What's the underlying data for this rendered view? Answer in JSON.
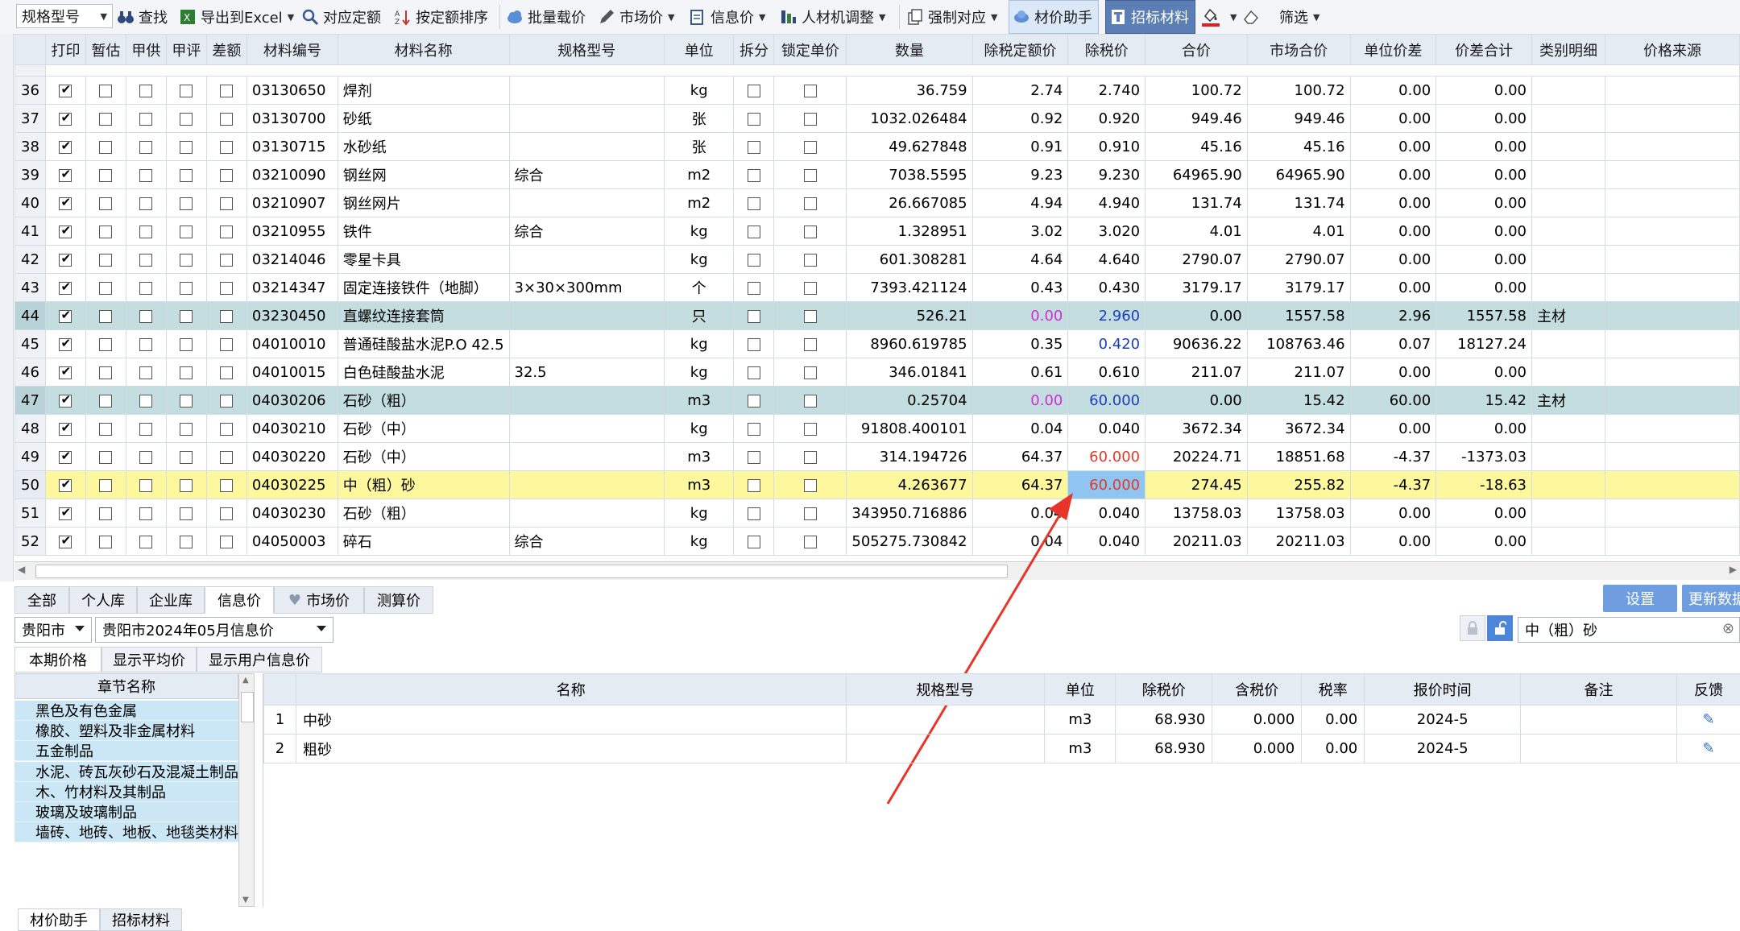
{
  "toolbar": {
    "spec_filter": "规格型号",
    "find": "查找",
    "export_excel": "导出到Excel",
    "match_quota": "对应定额",
    "sort_by_quota": "按定额排序",
    "batch_price": "批量载价",
    "market_price": "市场价",
    "info_price": "信息价",
    "labor_adjust": "人材机调整",
    "force_match": "强制对应",
    "material_assistant": "材价助手",
    "bid_material": "招标材料",
    "filter": "筛选"
  },
  "grid": {
    "columns": [
      "",
      "打印",
      "暂估",
      "甲供",
      "甲评",
      "差额",
      "材料编号",
      "材料名称",
      "规格型号",
      "单位",
      "拆分",
      "锁定单价",
      "数量",
      "除税定额价",
      "除税价",
      "合价",
      "市场合价",
      "单位价差",
      "价差合计",
      "类别明细",
      "价格来源"
    ],
    "rows": [
      {
        "rn": "36",
        "print": true,
        "code": "03130650",
        "name": "焊剂",
        "spec": "",
        "unit": "kg",
        "qty": "36.759",
        "quota": "2.74",
        "price": "2.740",
        "total": "100.72",
        "mtotal": "100.72",
        "diff": "0.00",
        "difft": "0.00",
        "cat": "",
        "style": ""
      },
      {
        "rn": "37",
        "print": true,
        "code": "03130700",
        "name": "砂纸",
        "spec": "",
        "unit": "张",
        "qty": "1032.026484",
        "quota": "0.92",
        "price": "0.920",
        "total": "949.46",
        "mtotal": "949.46",
        "diff": "0.00",
        "difft": "0.00",
        "cat": "",
        "style": ""
      },
      {
        "rn": "38",
        "print": true,
        "code": "03130715",
        "name": "水砂纸",
        "spec": "",
        "unit": "张",
        "qty": "49.627848",
        "quota": "0.91",
        "price": "0.910",
        "total": "45.16",
        "mtotal": "45.16",
        "diff": "0.00",
        "difft": "0.00",
        "cat": "",
        "style": ""
      },
      {
        "rn": "39",
        "print": true,
        "code": "03210090",
        "name": "钢丝网",
        "spec": "综合",
        "unit": "m2",
        "qty": "7038.5595",
        "quota": "9.23",
        "price": "9.230",
        "total": "64965.90",
        "mtotal": "64965.90",
        "diff": "0.00",
        "difft": "0.00",
        "cat": "",
        "style": ""
      },
      {
        "rn": "40",
        "print": true,
        "code": "03210907",
        "name": "钢丝网片",
        "spec": "",
        "unit": "m2",
        "qty": "26.667085",
        "quota": "4.94",
        "price": "4.940",
        "total": "131.74",
        "mtotal": "131.74",
        "diff": "0.00",
        "difft": "0.00",
        "cat": "",
        "style": ""
      },
      {
        "rn": "41",
        "print": true,
        "code": "03210955",
        "name": "铁件",
        "spec": "综合",
        "unit": "kg",
        "qty": "1.328951",
        "quota": "3.02",
        "price": "3.020",
        "total": "4.01",
        "mtotal": "4.01",
        "diff": "0.00",
        "difft": "0.00",
        "cat": "",
        "style": ""
      },
      {
        "rn": "42",
        "print": true,
        "code": "03214046",
        "name": "零星卡具",
        "spec": "",
        "unit": "kg",
        "qty": "601.308281",
        "quota": "4.64",
        "price": "4.640",
        "total": "2790.07",
        "mtotal": "2790.07",
        "diff": "0.00",
        "difft": "0.00",
        "cat": "",
        "style": ""
      },
      {
        "rn": "43",
        "print": true,
        "code": "03214347",
        "name": "固定连接铁件（地脚）",
        "spec": "3×30×300mm",
        "unit": "个",
        "qty": "7393.421124",
        "quota": "0.43",
        "price": "0.430",
        "total": "3179.17",
        "mtotal": "3179.17",
        "diff": "0.00",
        "difft": "0.00",
        "cat": "",
        "style": ""
      },
      {
        "rn": "44",
        "print": true,
        "code": "03230450",
        "name": "直螺纹连接套筒",
        "spec": "",
        "unit": "只",
        "qty": "526.21",
        "quota": "0.00",
        "price": "2.960",
        "total": "0.00",
        "mtotal": "1557.58",
        "diff": "2.96",
        "difft": "1557.58",
        "cat": "主材",
        "style": "zu"
      },
      {
        "rn": "45",
        "print": true,
        "code": "04010010",
        "name": "普通硅酸盐水泥P.O 42.5",
        "spec": "",
        "unit": "kg",
        "qty": "8960.619785",
        "quota": "0.35",
        "price": "0.420",
        "total": "90636.22",
        "mtotal": "108763.46",
        "diff": "0.07",
        "difft": "18127.24",
        "cat": "",
        "style": "blueprice"
      },
      {
        "rn": "46",
        "print": true,
        "code": "04010015",
        "name": "白色硅酸盐水泥",
        "spec": "32.5",
        "unit": "kg",
        "qty": "346.01841",
        "quota": "0.61",
        "price": "0.610",
        "total": "211.07",
        "mtotal": "211.07",
        "diff": "0.00",
        "difft": "0.00",
        "cat": "",
        "style": ""
      },
      {
        "rn": "47",
        "print": true,
        "code": "04030206",
        "name": "石砂（粗）",
        "spec": "",
        "unit": "m3",
        "qty": "0.25704",
        "quota": "0.00",
        "price": "60.000",
        "total": "0.00",
        "mtotal": "15.42",
        "diff": "60.00",
        "difft": "15.42",
        "cat": "主材",
        "style": "zu"
      },
      {
        "rn": "48",
        "print": true,
        "code": "04030210",
        "name": "石砂（中）",
        "spec": "",
        "unit": "kg",
        "qty": "91808.400101",
        "quota": "0.04",
        "price": "0.040",
        "total": "3672.34",
        "mtotal": "3672.34",
        "diff": "0.00",
        "difft": "0.00",
        "cat": "",
        "style": ""
      },
      {
        "rn": "49",
        "print": true,
        "code": "04030220",
        "name": "石砂（中）",
        "spec": "",
        "unit": "m3",
        "qty": "314.194726",
        "quota": "64.37",
        "price": "60.000",
        "total": "20224.71",
        "mtotal": "18851.68",
        "diff": "-4.37",
        "difft": "-1373.03",
        "cat": "",
        "style": "redprice"
      },
      {
        "rn": "50",
        "print": true,
        "code": "04030225",
        "name": "中（粗）砂",
        "spec": "",
        "unit": "m3",
        "qty": "4.263677",
        "quota": "64.37",
        "price": "60.000",
        "total": "274.45",
        "mtotal": "255.82",
        "diff": "-4.37",
        "difft": "-18.63",
        "cat": "",
        "style": "sel"
      },
      {
        "rn": "51",
        "print": true,
        "code": "04030230",
        "name": "石砂（粗）",
        "spec": "",
        "unit": "kg",
        "qty": "343950.716886",
        "quota": "0.04",
        "price": "0.040",
        "total": "13758.03",
        "mtotal": "13758.03",
        "diff": "0.00",
        "difft": "0.00",
        "cat": "",
        "style": ""
      },
      {
        "rn": "52",
        "print": true,
        "code": "04050003",
        "name": "碎石",
        "spec": "综合",
        "unit": "kg",
        "qty": "505275.730842",
        "quota": "0.04",
        "price": "0.040",
        "total": "20211.03",
        "mtotal": "20211.03",
        "diff": "0.00",
        "difft": "0.00",
        "cat": "",
        "style": ""
      }
    ]
  },
  "tabs": [
    "全部",
    "个人库",
    "企业库",
    "信息价",
    "市场价",
    "测算价"
  ],
  "buttons": {
    "settings": "设置",
    "update": "更新数据"
  },
  "filters": {
    "city": "贵阳市",
    "period": "贵阳市2024年05月信息价",
    "search_value": "中（粗）砂"
  },
  "subtabs": [
    "本期价格",
    "显示平均价",
    "显示用户信息价"
  ],
  "chapters": {
    "header": "章节名称",
    "items": [
      "黑色及有色金属",
      "橡胶、塑料及非金属材料",
      "五金制品",
      "水泥、砖瓦灰砂石及混凝土制品",
      "木、竹材料及其制品",
      "玻璃及玻璃制品",
      "墙砖、地砖、地板、地毯类材料"
    ]
  },
  "price_table": {
    "columns": [
      "",
      "名称",
      "规格型号",
      "单位",
      "除税价",
      "含税价",
      "税率",
      "报价时间",
      "备注",
      "反馈"
    ],
    "rows": [
      {
        "no": "1",
        "name": "中砂",
        "spec": "",
        "unit": "m3",
        "ex_tax": "68.930",
        "inc_tax": "0.000",
        "rate": "0.00",
        "time": "2024-5",
        "note": ""
      },
      {
        "no": "2",
        "name": "粗砂",
        "spec": "",
        "unit": "m3",
        "ex_tax": "68.930",
        "inc_tax": "0.000",
        "rate": "0.00",
        "time": "2024-5",
        "note": ""
      }
    ]
  },
  "bottom_tabs": [
    "材价助手",
    "招标材料"
  ],
  "colors": {
    "accent": "#5b7fb5",
    "selected_row": "#fdf79e",
    "main_material_row": "#c3dde0",
    "highlight_cell": "#90c4f1",
    "arrow": "#e8352a"
  }
}
